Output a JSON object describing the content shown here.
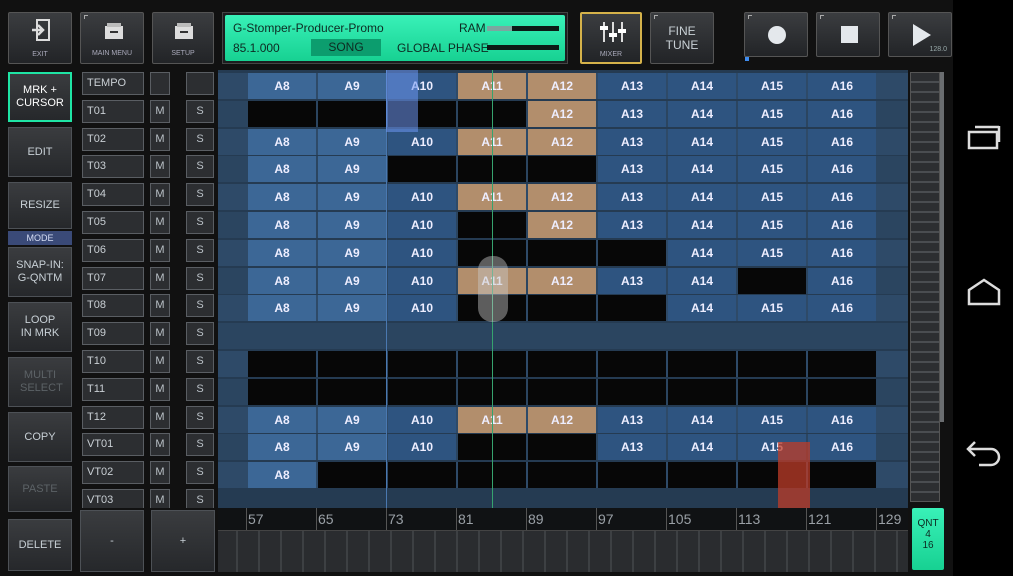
{
  "top_buttons": {
    "exit": "EXIT",
    "main_menu": "MAIN MENU",
    "setup": "SETUP",
    "mixer": "MIXER",
    "fine_tune": "FINE TUNE",
    "play_value": "128.0"
  },
  "display": {
    "song_name": "G-Stomper-Producer-Promo",
    "position": "85.1.000",
    "mode": "SONG",
    "ram_label": "RAM",
    "phase_label": "GLOBAL PHASE"
  },
  "left_buttons": {
    "mrk_cursor": "MRK + CURSOR",
    "edit": "EDIT",
    "resize": "RESIZE",
    "mode": "MODE",
    "snap": "SNAP-IN: G-QNTM",
    "loop": "LOOP IN MRK",
    "multi_select": "MULTI SELECT",
    "copy": "COPY",
    "paste": "PASTE",
    "delete": "DELETE",
    "minus": "-",
    "plus": "+"
  },
  "tracks": [
    "TEMPO",
    "T01",
    "T02",
    "T03",
    "T04",
    "T05",
    "T06",
    "T07",
    "T08",
    "T09",
    "T10",
    "T11",
    "T12",
    "VT01",
    "VT02",
    "VT03"
  ],
  "m_label": "M",
  "s_label": "S",
  "column_labels": [
    "A8",
    "A9",
    "A10",
    "A11",
    "A12",
    "A13",
    "A14",
    "A15",
    "A16"
  ],
  "ruler": [
    "57",
    "65",
    "73",
    "81",
    "89",
    "97",
    "105",
    "113",
    "121",
    "129"
  ],
  "qnt": {
    "label": "QNT",
    "top": "4",
    "bottom": "16"
  },
  "colors": {
    "blue": "#2e5480",
    "tan": "#b28e6c",
    "accent_green": "#1fe5a5"
  }
}
